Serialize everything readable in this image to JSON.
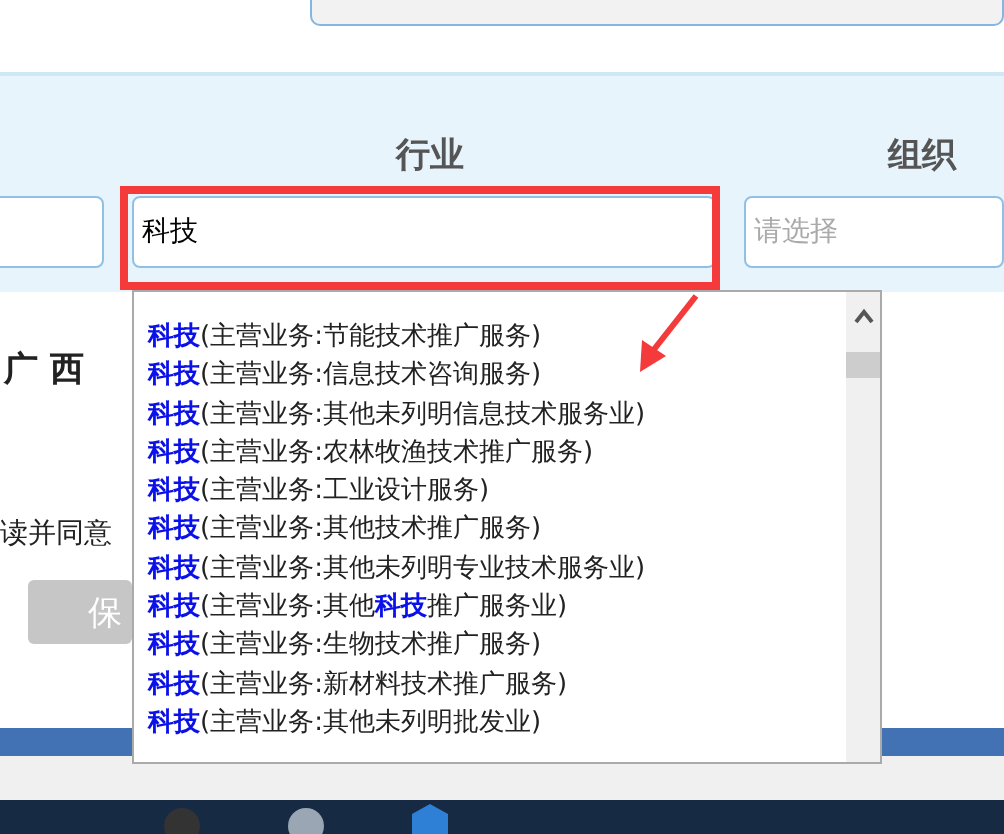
{
  "industry_label": "行业",
  "org_label": "组织",
  "industry_field": {
    "value": "科技"
  },
  "org_field": {
    "placeholder": "请选择"
  },
  "logo_text": "广 西",
  "agree_text": "读并同意",
  "save_button": "保",
  "suggestions": [
    {
      "text": "**科技**(主营业务:节能技术推广服务)"
    },
    {
      "text": "**科技**(主营业务:信息技术咨询服务)"
    },
    {
      "text": "**科技**(主营业务:其他未列明信息技术服务业)"
    },
    {
      "text": "**科技**(主营业务:农林牧渔技术推广服务)"
    },
    {
      "text": "**科技**(主营业务:工业设计服务)"
    },
    {
      "text": "**科技**(主营业务:其他技术推广服务)"
    },
    {
      "text": "**科技**(主营业务:其他未列明专业技术服务业)"
    },
    {
      "text": "**科技**(主营业务:其他**科技**推广服务业)"
    },
    {
      "text": "**科技**(主营业务:生物技术推广服务)"
    },
    {
      "text": "**科技**(主营业务:新材料技术推广服务)"
    },
    {
      "text": "**科技**(主营业务:其他未列明批发业)"
    }
  ]
}
